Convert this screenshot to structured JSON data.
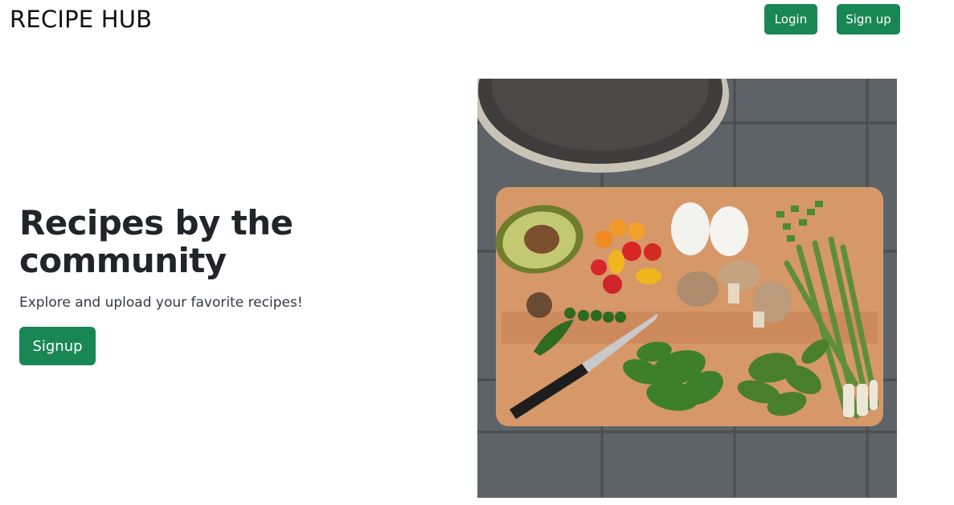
{
  "navbar": {
    "brand": "RECIPE HUB",
    "login_label": "Login",
    "signup_label": "Sign up"
  },
  "hero": {
    "title": "Recipes by the community",
    "subtitle": "Explore and upload your favorite recipes!",
    "cta_label": "Signup",
    "image_description": "cutting-board-vegetables-photo"
  },
  "colors": {
    "primary_button": "#198754",
    "text_dark": "#212529"
  }
}
